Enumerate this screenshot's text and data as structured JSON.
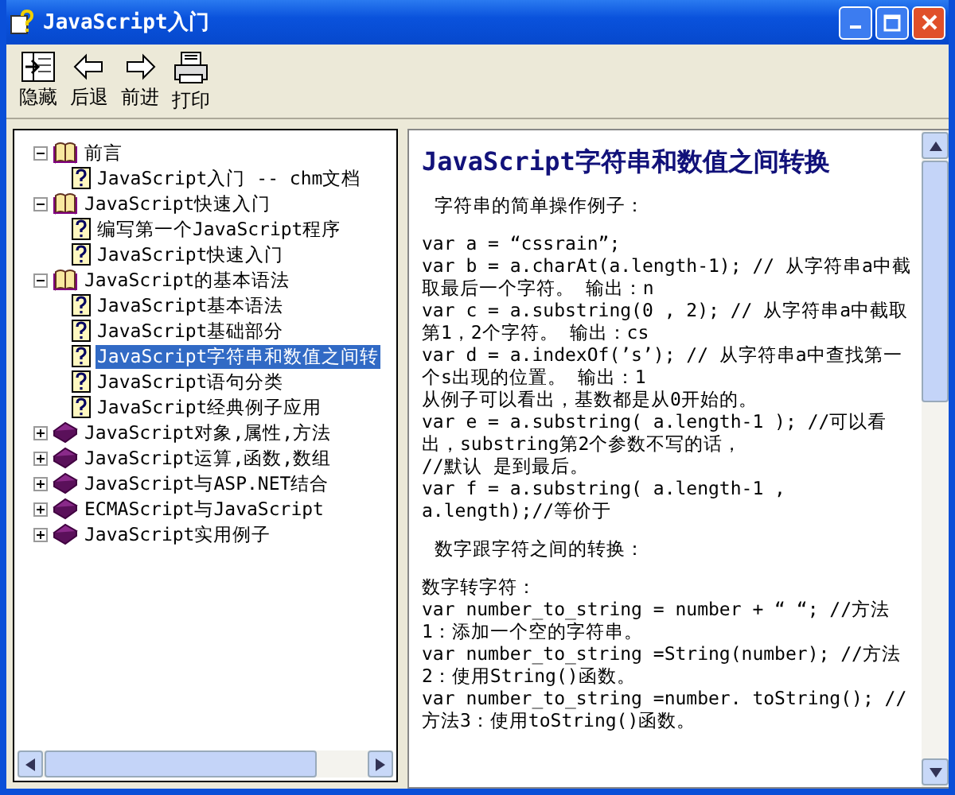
{
  "window": {
    "title": "JavaScript入门"
  },
  "toolbar": [
    {
      "kind": "hide",
      "label": "隐藏"
    },
    {
      "kind": "back",
      "label": "后退"
    },
    {
      "kind": "forward",
      "label": "前进"
    },
    {
      "kind": "print",
      "label": "打印"
    }
  ],
  "tree": [
    {
      "kind": "book",
      "label": "前言",
      "expanded": true,
      "selected": false,
      "children": [
        {
          "kind": "page",
          "label": "JavaScript入门 -- chm文档",
          "selected": false
        }
      ]
    },
    {
      "kind": "book",
      "label": "JavaScript快速入门",
      "expanded": true,
      "selected": false,
      "children": [
        {
          "kind": "page",
          "label": "编写第一个JavaScript程序",
          "selected": false
        },
        {
          "kind": "page",
          "label": "JavaScript快速入门",
          "selected": false
        }
      ]
    },
    {
      "kind": "book",
      "label": "JavaScript的基本语法",
      "expanded": true,
      "selected": false,
      "children": [
        {
          "kind": "page",
          "label": "JavaScript基本语法",
          "selected": false
        },
        {
          "kind": "page",
          "label": "JavaScript基础部分",
          "selected": false
        },
        {
          "kind": "page",
          "label": "JavaScript字符串和数值之间转",
          "selected": true
        },
        {
          "kind": "page",
          "label": "JavaScript语句分类",
          "selected": false
        },
        {
          "kind": "page",
          "label": "JavaScript经典例子应用",
          "selected": false
        }
      ]
    },
    {
      "kind": "book",
      "label": "JavaScript对象,属性,方法",
      "expanded": false,
      "selected": false
    },
    {
      "kind": "book",
      "label": "JavaScript运算,函数,数组",
      "expanded": false,
      "selected": false
    },
    {
      "kind": "book",
      "label": "JavaScript与ASP.NET结合",
      "expanded": false,
      "selected": false
    },
    {
      "kind": "book",
      "label": "ECMAScript与JavaScript",
      "expanded": false,
      "selected": false
    },
    {
      "kind": "book",
      "label": "JavaScript实用例子",
      "expanded": false,
      "selected": false
    }
  ],
  "article": [
    {
      "kind": "heading",
      "text": "JavaScript字符串和数值之间转换"
    },
    {
      "kind": "subheading",
      "text": "字符串的简单操作例子："
    },
    {
      "kind": "code",
      "text": "var a = “cssrain”;"
    },
    {
      "kind": "code",
      "text": "var b = a.charAt(a.length-1); // 从字符串a中截取最后一个字符。 输出：n"
    },
    {
      "kind": "code",
      "text": "var c = a.substring(0 , 2); // 从字符串a中截取第1，2个字符。 输出：cs"
    },
    {
      "kind": "code",
      "text": "var d = a.indexOf(’s’); // 从字符串a中查找第一个s出现的位置。 输出：1"
    },
    {
      "kind": "code",
      "text": "从例子可以看出，基数都是从0开始的。"
    },
    {
      "kind": "code",
      "text": "var e = a.substring( a.length-1 ); //可以看出，substring第2个参数不写的话，"
    },
    {
      "kind": "code",
      "text": "//默认 是到最后。"
    },
    {
      "kind": "code",
      "text": "var f = a.substring( a.length-1 , a.length);//等价于"
    },
    {
      "kind": "subheading",
      "text": "数字跟字符之间的转换："
    },
    {
      "kind": "code",
      "text": "数字转字符："
    },
    {
      "kind": "code",
      "text": "var number_to_string = number + “ “; //方法1：添加一个空的字符串。"
    },
    {
      "kind": "code",
      "text": "var number_to_string =String(number); //方法2：使用String()函数。"
    },
    {
      "kind": "code",
      "text": "var number_to_string =number. toString(); //方法3：使用toString()函数。"
    }
  ]
}
